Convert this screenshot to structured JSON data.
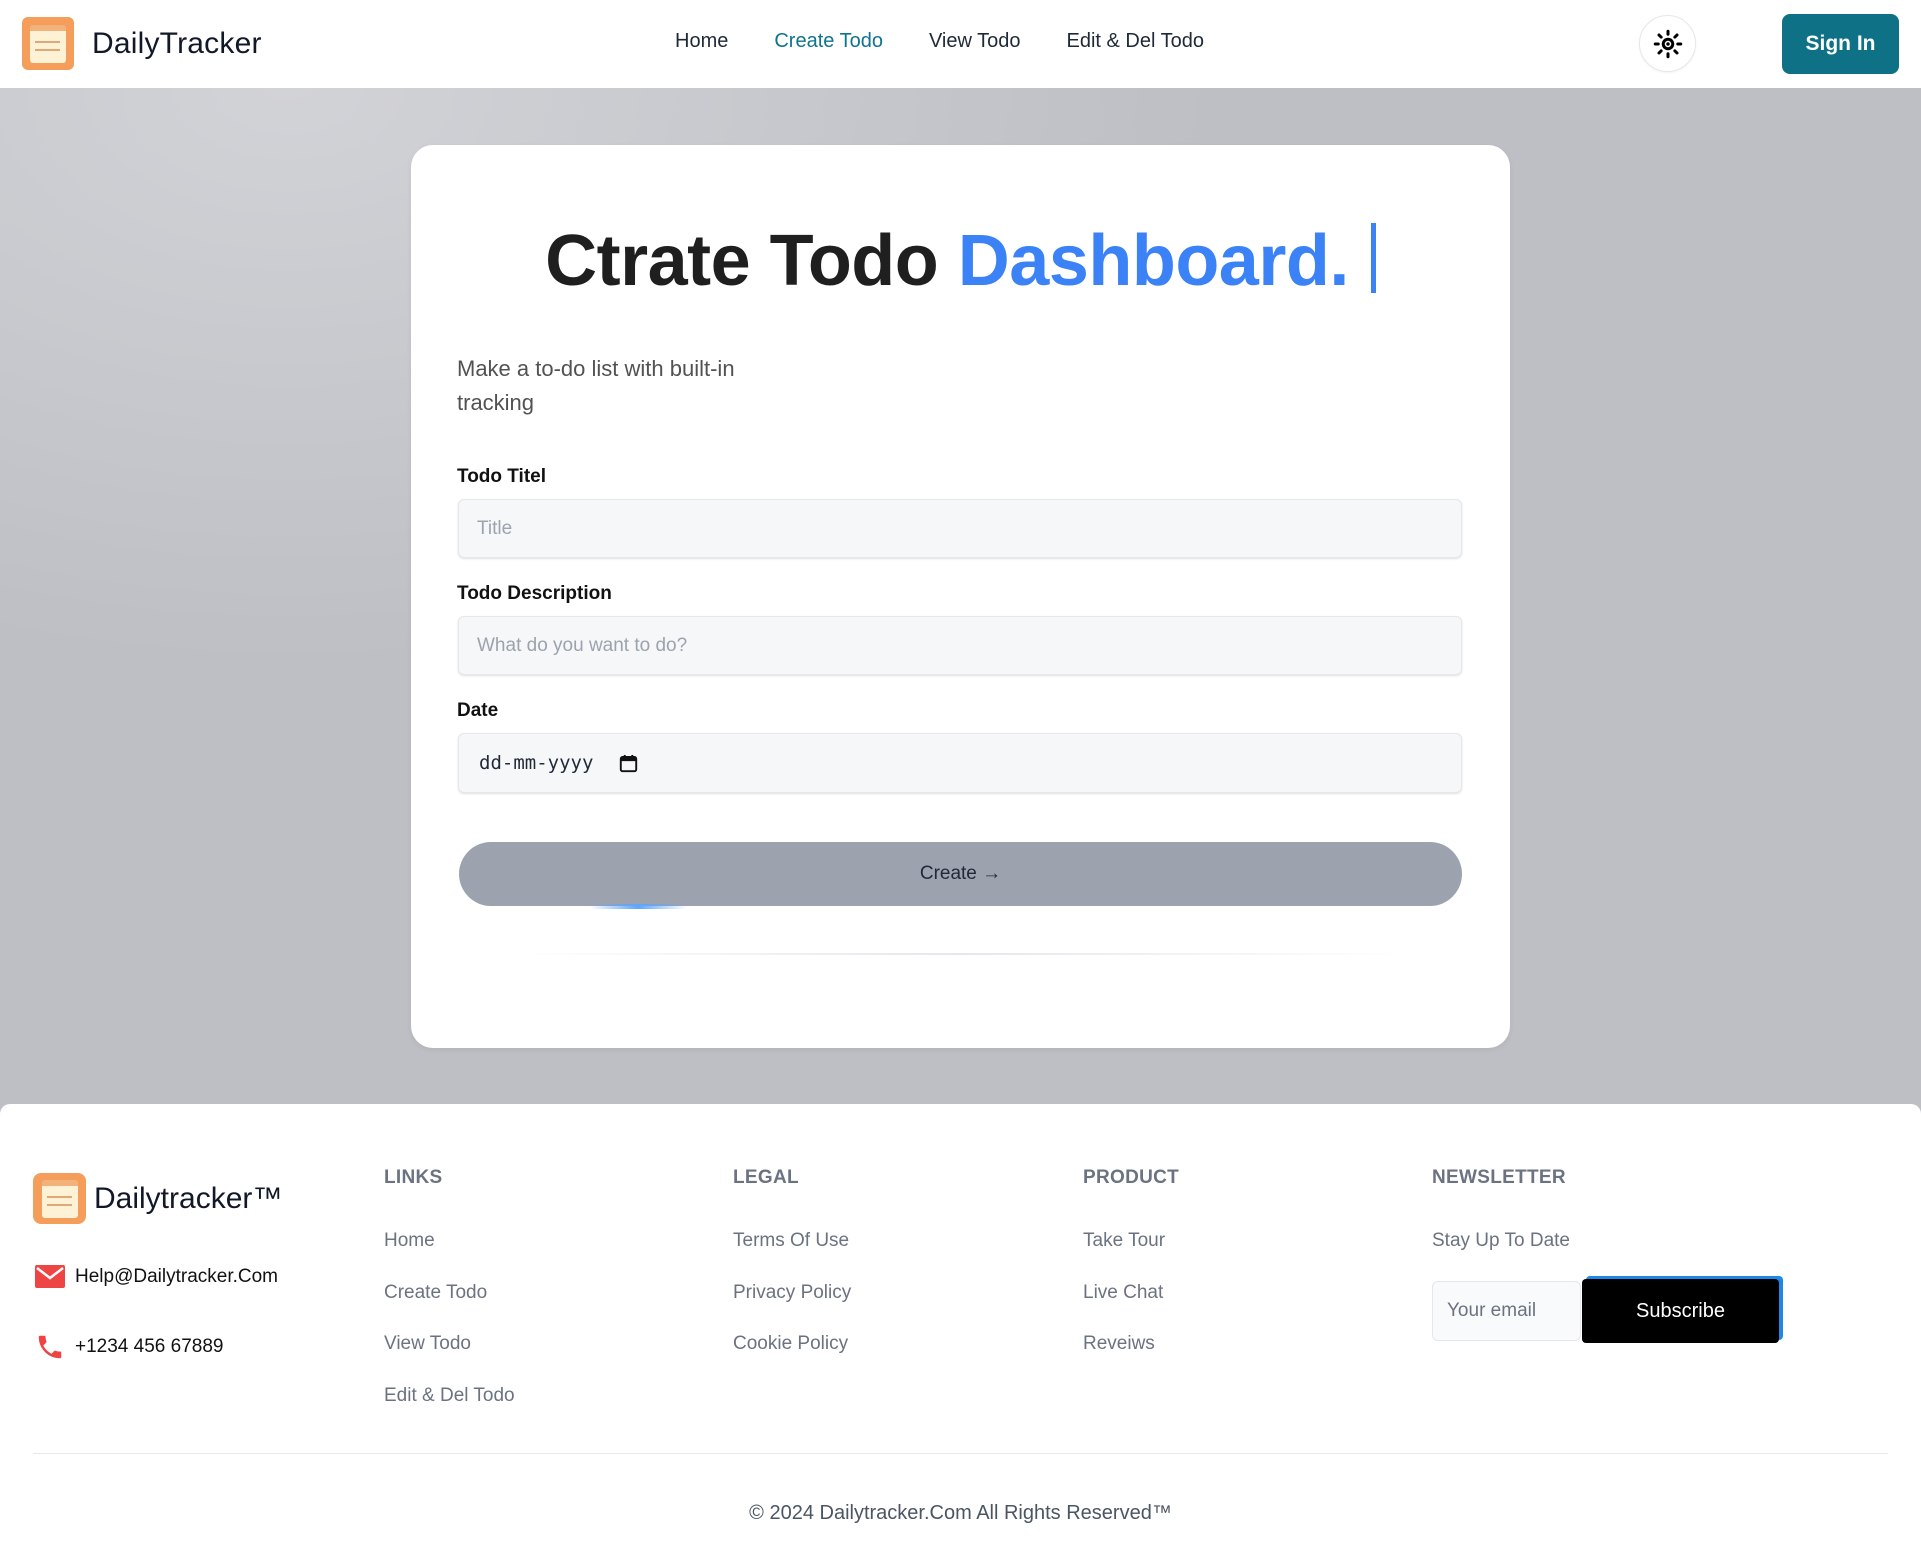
{
  "navbar": {
    "brand": "DailyTracker",
    "links": [
      "Home",
      "Create Todo",
      "View Todo",
      "Edit & Del Todo"
    ],
    "active_link": "Create Todo",
    "theme_icon": "sun-icon",
    "signin_label": "Sign In"
  },
  "form": {
    "title_main": "Ctrate Todo",
    "title_accent": "Dashboard.",
    "subtitle": "Make a to-do list with built-in tracking",
    "title_label": "Todo Titel",
    "title_placeholder": "Title",
    "description_label": "Todo Description",
    "description_placeholder": "What do you want to do?",
    "date_label": "Date",
    "date_value": "dd-mm-yyyy",
    "create_label": "Create →"
  },
  "footer": {
    "brand": "Dailytracker™",
    "email": "Help@Dailytracker.Com",
    "phone": "+1234 456 67889",
    "links_heading": "LINKS",
    "links": [
      "Home",
      "Create Todo",
      "View Todo",
      "Edit & Del Todo"
    ],
    "legal_heading": "LEGAL",
    "legal": [
      "Terms Of Use",
      "Privacy Policy",
      "Cookie Policy"
    ],
    "product_heading": "PRODUCT",
    "product": [
      "Take Tour",
      "Live Chat",
      "Reveiws"
    ],
    "newsletter_heading": "NEWSLETTER",
    "newsletter_text": "Stay Up To Date",
    "email_placeholder": "Your email",
    "subscribe_label": "Subscribe",
    "copyright": "© 2024 Dailytracker.Com All Rights Reserved™"
  },
  "colors": {
    "accent": "#3b82f6",
    "primary": "#0f7185",
    "active_link": "#0e7490",
    "background": "#bdbfc5"
  }
}
